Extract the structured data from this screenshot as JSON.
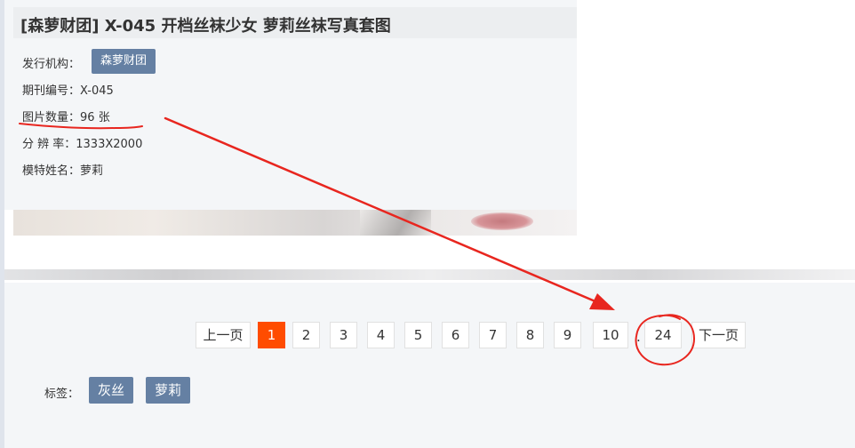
{
  "title": "[森萝财团] X-045 开档丝袜少女 萝莉丝袜写真套图",
  "info": {
    "publisher_label": "发行机构：",
    "publisher_value": "森萝财团",
    "issue_label": "期刊编号：",
    "issue_value": "X-045",
    "count_label": "图片数量：",
    "count_value": "96 张",
    "resolution_label": "分 辨 率：",
    "resolution_value": "1333X2000",
    "model_label": "模特姓名：",
    "model_value": "萝莉"
  },
  "pagination": {
    "prev_label": "上一页",
    "pages": [
      "1",
      "2",
      "3",
      "4",
      "5",
      "6",
      "7",
      "8",
      "9",
      "10"
    ],
    "active_page": "1",
    "ellipsis": ".",
    "last_page": "24",
    "next_label": "下一页"
  },
  "tags": {
    "label": "标签：",
    "items": [
      "灰丝",
      "萝莉"
    ]
  },
  "colors": {
    "accent": "#ff4c00",
    "button_blue": "#6580a3",
    "annotation_red": "#e8261f"
  }
}
